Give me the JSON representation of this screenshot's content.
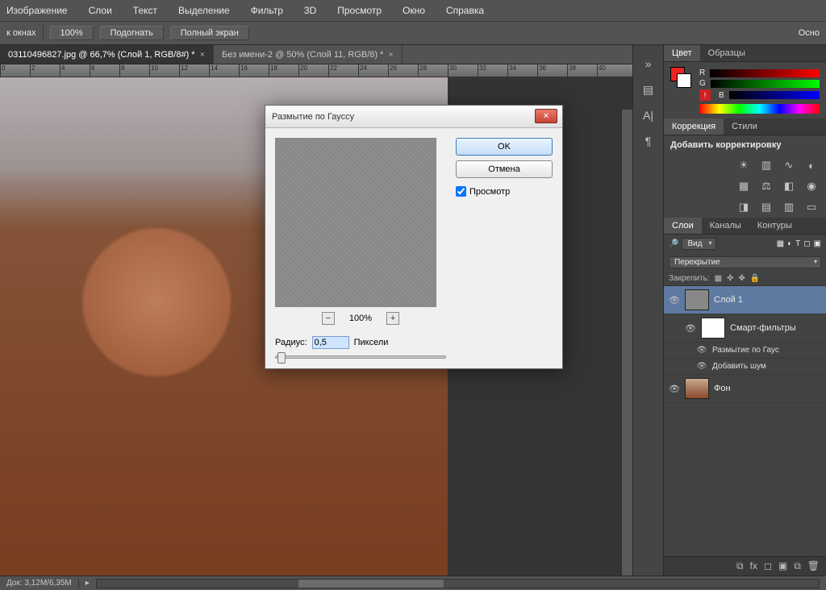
{
  "menu": {
    "items": [
      "Изображение",
      "Слои",
      "Текст",
      "Выделение",
      "Фильтр",
      "3D",
      "Просмотр",
      "Окно",
      "Справка"
    ]
  },
  "options": {
    "windows_fragment": "к окнах",
    "zoom_pct": "100%",
    "fit": "Подогнать",
    "fullscreen": "Полный экран",
    "right_fragment": "Осно"
  },
  "tabs": {
    "active": "03110496827.jpg @ 66,7% (Слой 1, RGB/8#) *",
    "inactive": "Без имени-2 @ 50% (Слой 11, RGB/8) *"
  },
  "ruler_ticks": [
    0,
    2,
    4,
    6,
    8,
    10,
    12,
    14,
    16,
    18,
    20,
    22,
    24,
    26,
    28,
    30,
    32,
    34,
    36,
    38,
    40
  ],
  "status": {
    "doc": "Док: 3,12M/6,35M",
    "arrow": "▸"
  },
  "dialog": {
    "title": "Размытие по Гауссу",
    "ok": "OK",
    "cancel": "Отмена",
    "preview_chk": "Просмотр",
    "zoom": "100%",
    "minus": "−",
    "plus": "+",
    "radius_label": "Радиус:",
    "radius_value": "0,5",
    "radius_unit": "Пиксели",
    "close_x": "✕"
  },
  "panel_color": {
    "tab_color": "Цвет",
    "tab_swatches": "Образцы",
    "r": "R",
    "g": "G",
    "b": "B",
    "warn": "!"
  },
  "panel_adjust": {
    "tab_adjust": "Коррекция",
    "tab_styles": "Стили",
    "add": "Добавить корректировку"
  },
  "panel_layers": {
    "tab_layers": "Слои",
    "tab_channels": "Каналы",
    "tab_paths": "Контуры",
    "kind_label": "Вид",
    "search_glyph": "🔎",
    "blend": "Перекрытие",
    "lock_label": "Закрепить:",
    "layer1": "Слой 1",
    "smart": "Смарт-фильтры",
    "fx1": "Размытие по Гаус",
    "fx2": "Добавить шум",
    "bg": "Фон"
  },
  "icons": {
    "double_arrow": "»",
    "histogram": "▤",
    "char": "A|",
    "para": "¶",
    "fx": "fx",
    "mask": "◻",
    "folder": "▣",
    "new": "⧉",
    "trash": "🗑",
    "link": "⧉",
    "eye": "👁"
  }
}
